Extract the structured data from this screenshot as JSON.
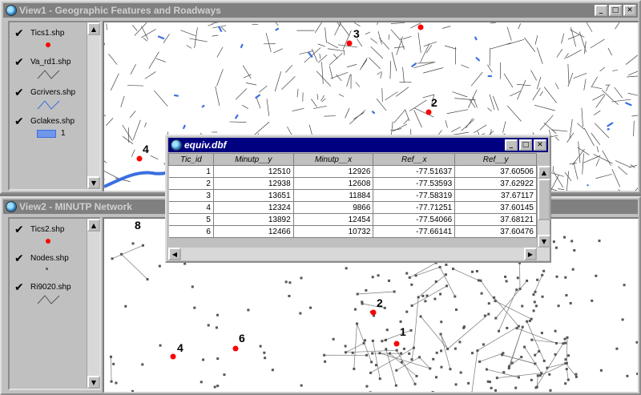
{
  "view1": {
    "title": "View1 - Geographic Features and Roadways",
    "legend": [
      {
        "label": "Tics1.shp",
        "symbol": "point"
      },
      {
        "label": "Va_rd1.shp",
        "symbol": "line"
      },
      {
        "label": "Gcrivers.shp",
        "symbol": "river"
      },
      {
        "label": "Gclakes.shp",
        "symbol": "poly",
        "class_label": "1"
      }
    ],
    "tic_labels": [
      "3",
      "2",
      "4"
    ]
  },
  "view2": {
    "title": "View2 - MINUTP Network",
    "legend": [
      {
        "label": "Tics2.shp",
        "symbol": "point"
      },
      {
        "label": "Nodes.shp",
        "symbol": "dot"
      },
      {
        "label": "Ri9020.shp",
        "symbol": "line"
      }
    ],
    "tic_labels": [
      "8",
      "2",
      "1",
      "4",
      "6"
    ]
  },
  "table": {
    "title": "equiv.dbf",
    "columns": [
      "Tic_id",
      "Minutp__y",
      "Minutp__x",
      "Ref__x",
      "Ref__y"
    ],
    "rows": [
      [
        "1",
        "12510",
        "12926",
        "-77.51637",
        "37.60506"
      ],
      [
        "2",
        "12938",
        "12608",
        "-77.53593",
        "37.62922"
      ],
      [
        "3",
        "13651",
        "11884",
        "-77.58319",
        "37.67117"
      ],
      [
        "4",
        "12324",
        "9866",
        "-77.71251",
        "37.60145"
      ],
      [
        "5",
        "13892",
        "12454",
        "-77.54066",
        "37.68121"
      ],
      [
        "6",
        "12466",
        "10732",
        "-77.66141",
        "37.60476"
      ]
    ]
  },
  "window_buttons": {
    "minimize": "_",
    "maximize": "□",
    "close": "✕"
  },
  "colors": {
    "active_title": "#000080",
    "tic_point": "#ff0000",
    "water": "#3b6fe0"
  }
}
